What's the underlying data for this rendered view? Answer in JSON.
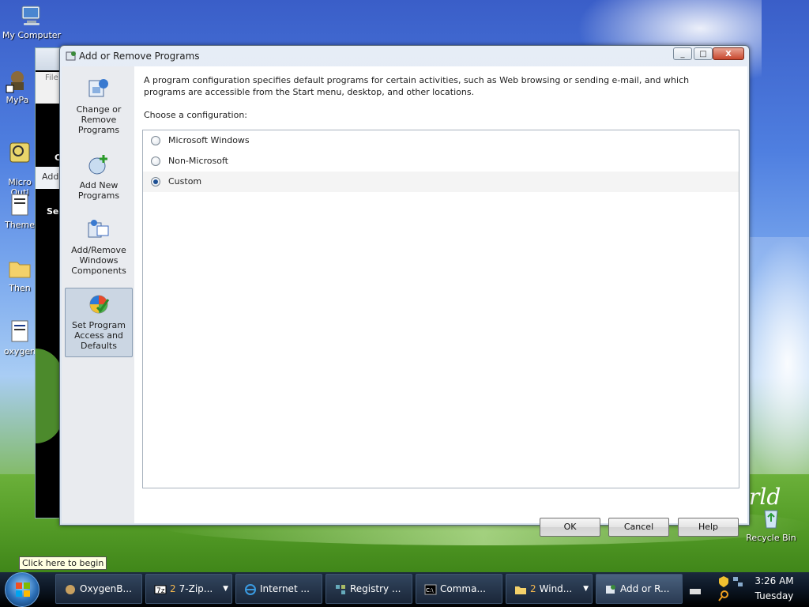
{
  "desktop": {
    "icons": [
      {
        "label": "My Computer"
      },
      {
        "label": "MyPa"
      },
      {
        "label": "Micro\nOutl"
      },
      {
        "label": "Theme"
      },
      {
        "label": "Then"
      },
      {
        "label": "oxygen"
      },
      {
        "label": "Recycle Bin"
      }
    ],
    "wallpaper_text": "rld"
  },
  "background_window": {
    "fragments": [
      "File",
      "Add",
      "C",
      "Se"
    ]
  },
  "window": {
    "title": "Add or Remove Programs",
    "controls": {
      "minimize": "_",
      "maximize": "□",
      "close": "X"
    },
    "sidebar": [
      {
        "label": "Change or Remove Programs",
        "icon": "change-remove-programs-icon",
        "active": false
      },
      {
        "label": "Add New Programs",
        "icon": "add-new-programs-icon",
        "active": false
      },
      {
        "label": "Add/Remove Windows Components",
        "icon": "windows-components-icon",
        "active": false
      },
      {
        "label": "Set Program Access and Defaults",
        "icon": "program-access-icon",
        "active": true
      }
    ],
    "description": "A program configuration specifies default programs for certain activities, such as Web browsing or sending e-mail, and which programs are accessible from the Start menu, desktop, and other locations.",
    "choose_label": "Choose a configuration:",
    "options": [
      {
        "label": "Microsoft Windows",
        "selected": false
      },
      {
        "label": "Non-Microsoft",
        "selected": false
      },
      {
        "label": "Custom",
        "selected": true
      }
    ],
    "buttons": {
      "ok": "OK",
      "cancel": "Cancel",
      "help": "Help"
    }
  },
  "tooltip": "Click here to begin",
  "taskbar": {
    "tasks": [
      {
        "label": "OxygenB...",
        "icon": "oxygen-icon",
        "count": "",
        "dropdown": false
      },
      {
        "label": "7-Zip...",
        "icon": "7zip-icon",
        "count": "2",
        "dropdown": true
      },
      {
        "label": "Internet ...",
        "icon": "internet-explorer-icon",
        "count": "",
        "dropdown": false
      },
      {
        "label": "Registry ...",
        "icon": "registry-icon",
        "count": "",
        "dropdown": false
      },
      {
        "label": "Comma...",
        "icon": "command-prompt-icon",
        "count": "",
        "dropdown": false
      },
      {
        "label": "Wind...",
        "icon": "folder-icon",
        "count": "2",
        "dropdown": true
      },
      {
        "label": "Add or R...",
        "icon": "add-remove-icon",
        "count": "",
        "dropdown": false
      }
    ],
    "clock": {
      "time": "3:26 AM",
      "day": "Tuesday"
    }
  }
}
